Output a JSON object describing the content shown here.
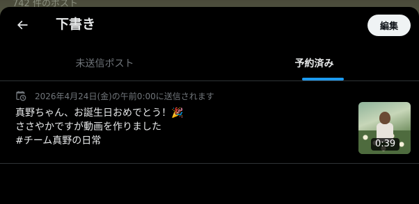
{
  "background": {
    "posts_count_text": "742 件のポスト"
  },
  "header": {
    "back_icon": "arrow-left-icon",
    "title": "下書き",
    "edit_label": "編集"
  },
  "tabs": [
    {
      "label": "未送信ポスト",
      "selected": false
    },
    {
      "label": "予約済み",
      "selected": true
    }
  ],
  "scheduled_post": {
    "schedule_icon": "clock-calendar-icon",
    "schedule_text": "2026年4月24日(金)の午前0:00に送信されます",
    "lines": [
      "真野ちゃん、お誕生日おめでとう！",
      "ささやかですが動画を作りました",
      "#チーム真野の日常"
    ],
    "emoji": "🎉",
    "thumbnail_icon": "video-thumbnail",
    "video_duration": "0:39"
  },
  "colors": {
    "background": "#000000",
    "text_primary": "#e7e9ea",
    "text_secondary": "#71767b",
    "accent": "#1d9bf0",
    "divider": "#2f3336",
    "edit_button_bg": "#eff3f4"
  }
}
